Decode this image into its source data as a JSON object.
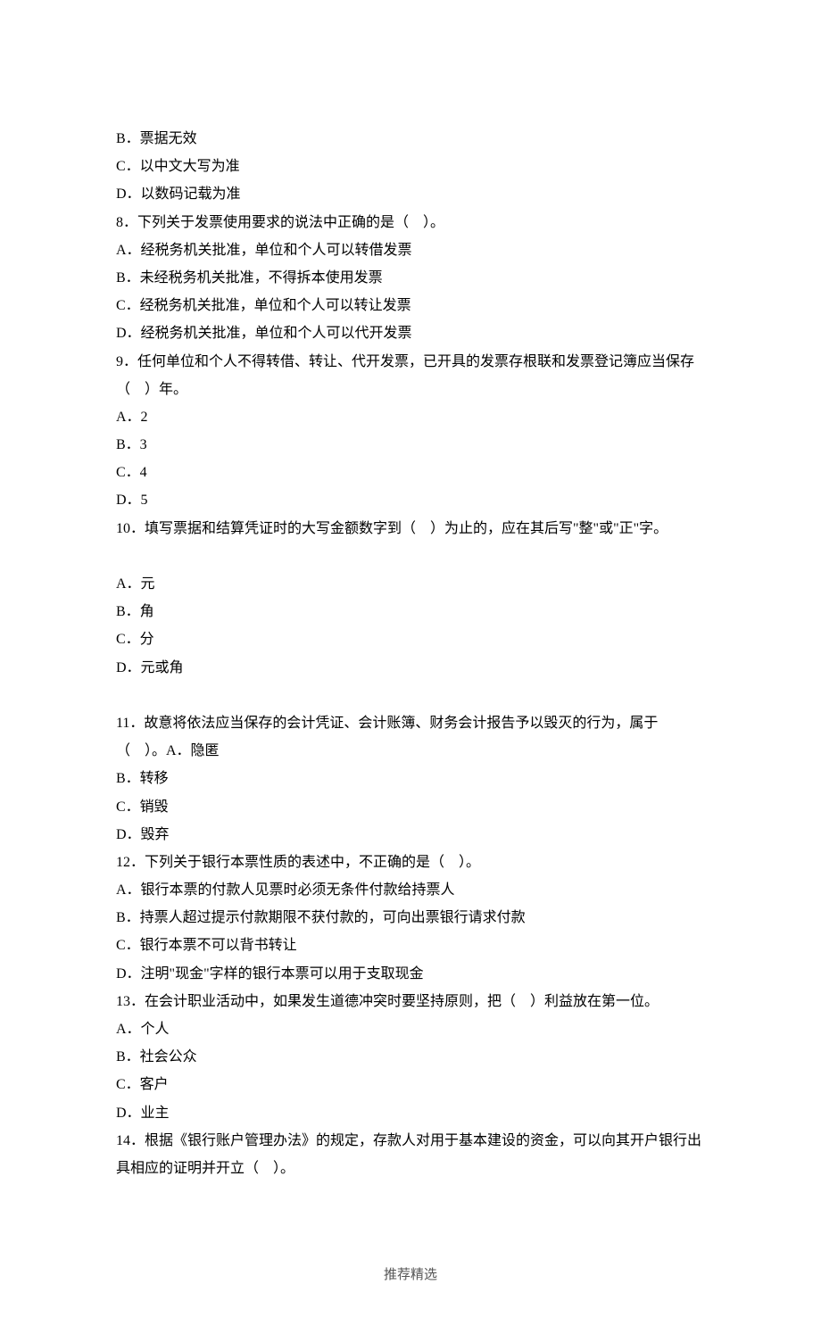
{
  "lines": [
    "B．票据无效",
    "C．以中文大写为准",
    "D．以数码记载为准",
    "8．下列关于发票使用要求的说法中正确的是（　）。",
    "A．经税务机关批准，单位和个人可以转借发票",
    "B．未经税务机关批准，不得拆本使用发票",
    "C．经税务机关批准，单位和个人可以转让发票",
    "D．经税务机关批准，单位和个人可以代开发票",
    "9．任何单位和个人不得转借、转让、代开发票，已开具的发票存根联和发票登记簿应当保存（　）年。",
    "A．2",
    "B．3",
    "C．4",
    "D．5",
    "10．填写票据和结算凭证时的大写金额数字到（　）为止的，应在其后写\"整\"或\"正\"字。",
    "",
    "A．元",
    "B．角",
    "C．分",
    "D．元或角",
    "",
    "11．故意将依法应当保存的会计凭证、会计账簿、财务会计报告予以毁灭的行为，属于（　）。A．隐匿",
    "B．转移",
    "C．销毁",
    "D．毁弃",
    "12．下列关于银行本票性质的表述中，不正确的是（　）。",
    "A．银行本票的付款人见票时必须无条件付款给持票人",
    "B．持票人超过提示付款期限不获付款的，可向出票银行请求付款",
    "C．银行本票不可以背书转让",
    "D．注明\"现金\"字样的银行本票可以用于支取现金",
    "13．在会计职业活动中，如果发生道德冲突时要坚持原则，把（　）利益放在第一位。",
    "A．个人",
    "B．社会公众",
    "C．客户",
    "D．业主",
    "14．根据《银行账户管理办法》的规定，存款人对用于基本建设的资金，可以向其开户银行出具相应的证明并开立（　）。"
  ],
  "footer": "推荐精选"
}
